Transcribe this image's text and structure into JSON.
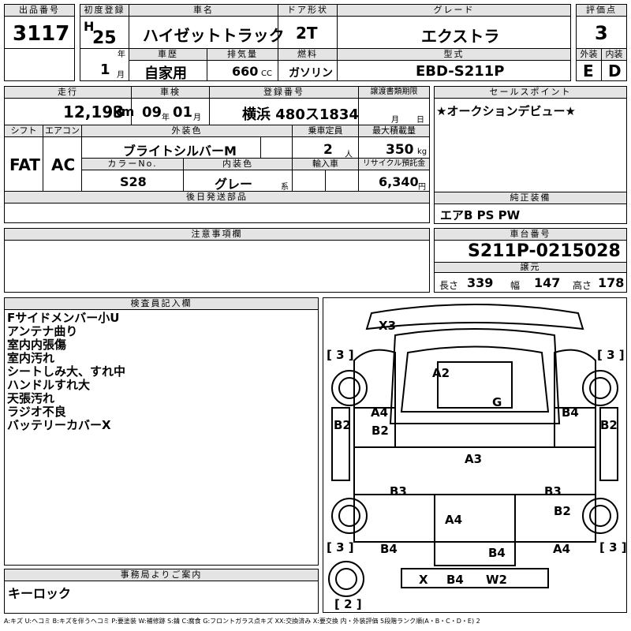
{
  "labels": {
    "lot_no": "出品番号",
    "first_reg": "初度登録",
    "car_name": "車名",
    "door": "ドア形状",
    "grade": "グレード",
    "score": "評価点",
    "history": "車歴",
    "displacement": "排気量",
    "fuel": "燃料",
    "model_code": "型式",
    "exterior": "外装",
    "interior": "内装",
    "mileage": "走行",
    "inspection": "車検",
    "reg_no": "登録番号",
    "transfer_deadline": "譲渡書類期限",
    "sales_point": "セールスポイント",
    "shift": "シフト",
    "aircon": "エアコン",
    "body_color": "外装色",
    "capacity": "乗車定員",
    "max_load": "最大積載量",
    "color_no": "カラーNo.",
    "interior_color": "内装色",
    "import": "輸入車",
    "recycle": "リサイクル預託金",
    "later_parts": "後日発送部品",
    "genuine_equip": "純正装備",
    "caution": "注意事項欄",
    "chassis_no": "車台番号",
    "prev_label": "譲元",
    "inspector_notes": "検査員記入欄",
    "office_notice": "事務局よりご案内"
  },
  "values": {
    "lot_no": "3117",
    "era": "H",
    "year": "25",
    "year_unit": "年",
    "month": "1",
    "month_unit": "月",
    "car_name": "ハイゼットトラック",
    "door": "2T",
    "grade": "エクストラ",
    "score": "3",
    "history": "自家用",
    "displacement": "660",
    "displacement_unit": "CC",
    "fuel": "ガソリン",
    "model_code": "EBD-S211P",
    "exterior": "E",
    "interior": "D",
    "mileage": "12,193",
    "mileage_unit": "km",
    "insp_year": "09",
    "insp_year_unit": "年",
    "insp_month": "01",
    "insp_month_unit": "月",
    "reg_no": "横浜 480ス1834",
    "deadline_month_unit": "月",
    "deadline_day_unit": "日",
    "sales_point": "★オークションデビュー★",
    "shift": "FAT",
    "aircon": "AC",
    "body_color": "ブライトシルバーM",
    "capacity": "2",
    "capacity_unit": "人",
    "max_load": "350",
    "max_load_unit": "kg",
    "color_no": "S28",
    "interior_color": "グレー",
    "interior_color_suffix": "系",
    "recycle": "6,340",
    "recycle_unit": "円",
    "genuine_equip": "エアB PS PW",
    "chassis_no": "S211P-0215028",
    "length_label": "長さ",
    "length": "339",
    "width_label": "幅",
    "width": "147",
    "height_label": "高さ",
    "height": "178",
    "office_notice": "キーロック"
  },
  "inspector_notes": [
    "Fサイドメンバー小U",
    "アンテナ曲り",
    "室内内張傷",
    "室内汚れ",
    "シートしみ大、すれ中",
    "ハンドルすれ大",
    "天張汚れ",
    "ラジオ不良",
    "バッテリーカバーX"
  ],
  "diagram": {
    "tires": {
      "front_left": "[ 3 ]",
      "front_right": "[ 3 ]",
      "rear_left": "[ 3 ]",
      "rear_right": "[ 3 ]",
      "spare": "[ 2 ]"
    },
    "marks": {
      "front_bumper": "X3",
      "hood": "A2",
      "windshield": "G",
      "left_front_door": "A4",
      "left_front_door_2": "B2",
      "left_fender": "B2",
      "right_front_door": "B4",
      "right_fender": "B2",
      "cab_roof": "A3",
      "left_sill": "B3",
      "right_sill": "B3",
      "bed_floor": "A4",
      "right_rear": "B2",
      "left_rear": "B4",
      "tailgate": "B4",
      "right_rear_2": "A4",
      "rear_x": "X",
      "rear_b4": "B4",
      "rear_w2": "W2"
    }
  },
  "legend": "A:キズ U:ヘコミ B:キズを伴うヘコミ P:要塗装 W:補修跡 S:錆 C:腐食 G:フロントガラス点キズ XX:交換済み X:要交換 内・外装評価 5段階ランク順(A・B・C・D・E) 2"
}
